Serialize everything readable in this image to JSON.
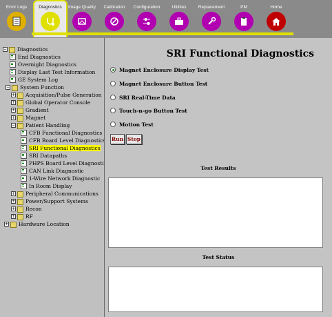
{
  "toolbar": {
    "tabs": [
      {
        "label": "Error Logs",
        "color": "#e0b000",
        "icon": "notebook-icon"
      },
      {
        "label": "Diagnostics",
        "color": "#e0e000",
        "icon": "stethoscope-icon"
      },
      {
        "label": "Image Quality",
        "color": "#b000b0",
        "icon": "scan-icon"
      },
      {
        "label": "Calibration",
        "color": "#b000b0",
        "icon": "calibration-icon"
      },
      {
        "label": "Configuration",
        "color": "#b000b0",
        "icon": "sliders-icon"
      },
      {
        "label": "Utilities",
        "color": "#b000b0",
        "icon": "toolbox-icon"
      },
      {
        "label": "Replacement",
        "color": "#b000b0",
        "icon": "wrench-icon"
      },
      {
        "label": "PM",
        "color": "#b000b0",
        "icon": "clipboard-icon"
      },
      {
        "label": "Home",
        "color": "#c00000",
        "icon": "home-icon"
      }
    ]
  },
  "tree": {
    "items": [
      {
        "label": "Diagnostics"
      },
      {
        "label": "End Diagnostics"
      },
      {
        "label": "Overnight Diagnostics"
      },
      {
        "label": "Display Last Test Information"
      },
      {
        "label": "GE System Log"
      },
      {
        "label": "System Function"
      },
      {
        "label": "Acquisition/Pulse Generation"
      },
      {
        "label": "Global Operator Console"
      },
      {
        "label": "Gradient"
      },
      {
        "label": "Magnet"
      },
      {
        "label": "Patient Handling"
      },
      {
        "label": "CFB Functional Diagnostics"
      },
      {
        "label": "CFB Board Level Diagnostics"
      },
      {
        "label": "SRI Functional Diagnostics"
      },
      {
        "label": "SRI Datapaths"
      },
      {
        "label": "PHPS Board Level Diagnostics"
      },
      {
        "label": "CAN Link Diagnostic"
      },
      {
        "label": "1-Wire Network Diagnostic"
      },
      {
        "label": "In Room Display"
      },
      {
        "label": "Peripheral Communications"
      },
      {
        "label": "Power/Support Systems"
      },
      {
        "label": "Recon"
      },
      {
        "label": "RF"
      },
      {
        "label": "Hardware Location"
      }
    ]
  },
  "main": {
    "title": "SRI Functional Diagnostics",
    "options": [
      {
        "label": "Magnet Enclosure Display Test"
      },
      {
        "label": "Magnet Enclosure Button Test"
      },
      {
        "label": "SRI Real-Time Data"
      },
      {
        "label": "Touch-n-go Button Test"
      },
      {
        "label": "Motion Test"
      }
    ],
    "run_label": "Run",
    "stop_label": "Stop",
    "results_label": "Test Results",
    "status_label": "Test Status"
  }
}
